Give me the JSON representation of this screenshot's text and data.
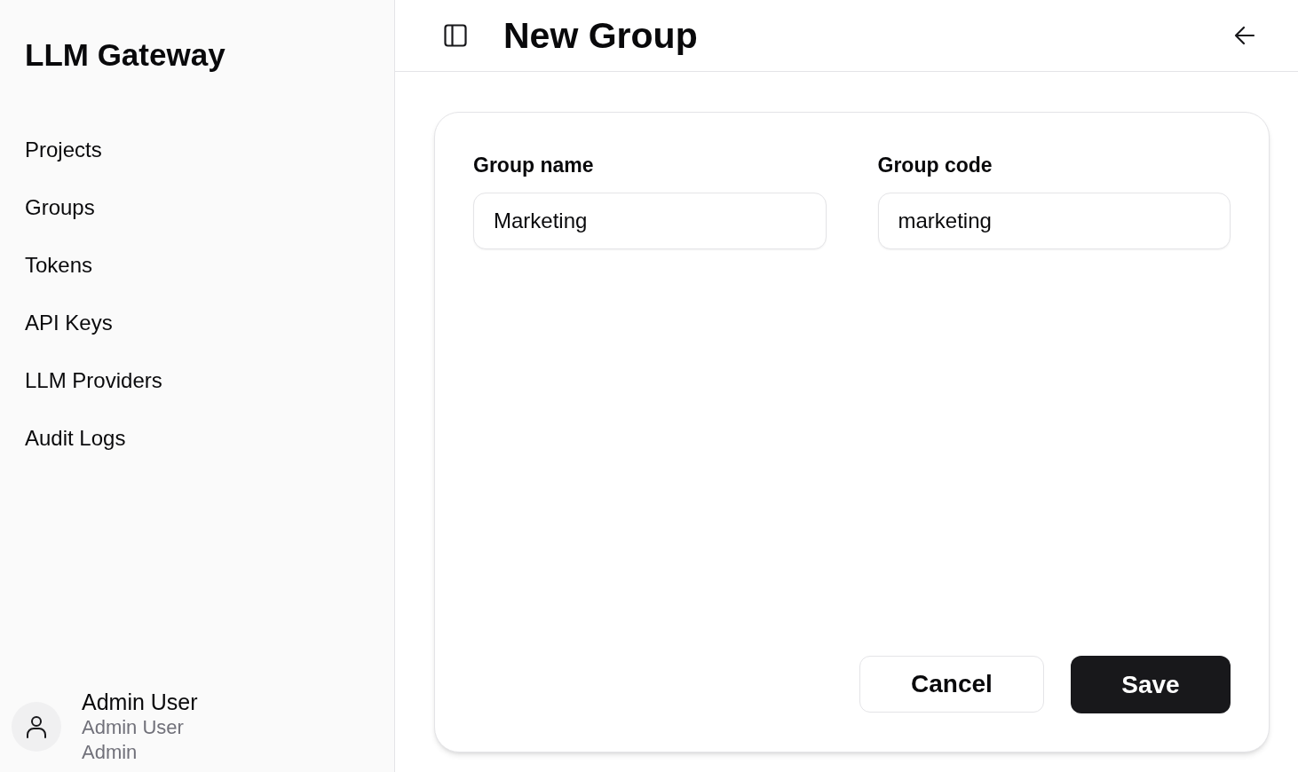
{
  "sidebar": {
    "title": "LLM Gateway",
    "items": [
      {
        "label": "Projects"
      },
      {
        "label": "Groups"
      },
      {
        "label": "Tokens"
      },
      {
        "label": "API Keys"
      },
      {
        "label": "LLM Providers"
      },
      {
        "label": "Audit Logs"
      }
    ],
    "user": {
      "name": "Admin User",
      "display_name": "Admin User",
      "role": "Admin"
    }
  },
  "header": {
    "title": "New Group"
  },
  "form": {
    "fields": [
      {
        "label": "Group name",
        "value": "Marketing"
      },
      {
        "label": "Group code",
        "value": "marketing"
      }
    ],
    "buttons": [
      {
        "label": "Cancel",
        "kind": "secondary"
      },
      {
        "label": "Save",
        "kind": "primary"
      }
    ]
  }
}
